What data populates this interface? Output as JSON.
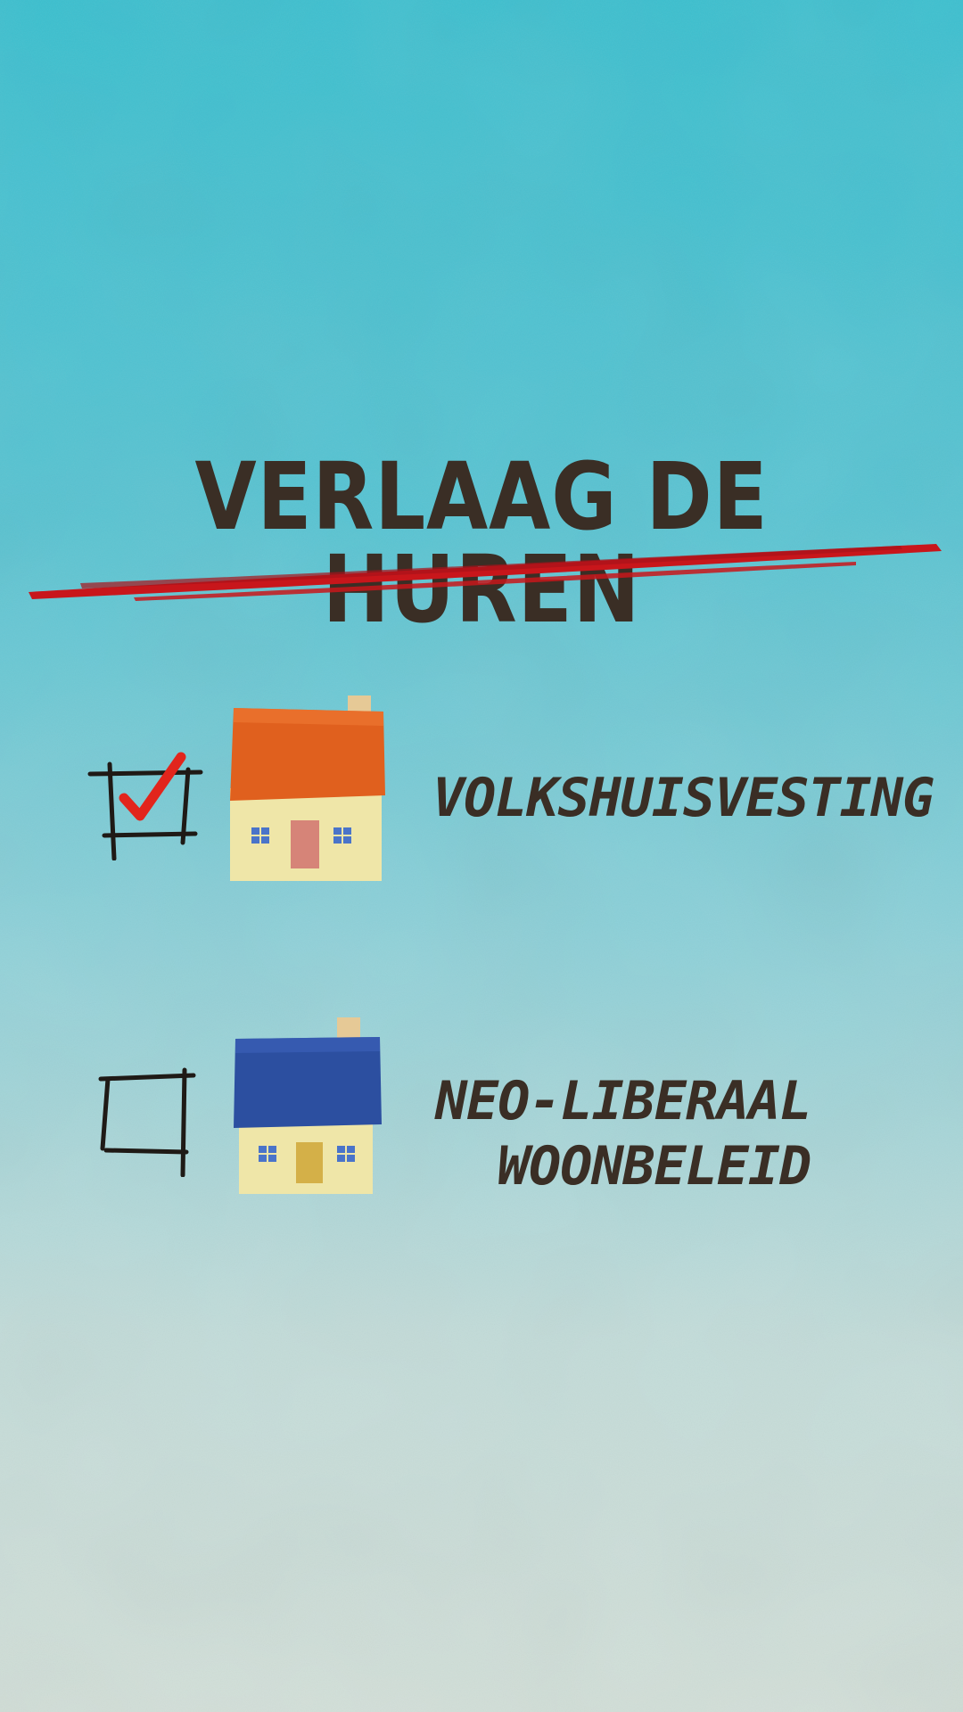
{
  "headline": "VERLAAG DE HUREN",
  "colors": {
    "background_top": "#39bfcf",
    "background_bottom": "#d2dfd8",
    "ink": "#3a2e25",
    "underline": "#c8161b",
    "check": "#e2251c"
  },
  "options": [
    {
      "label_lines": [
        "VOLKSHUISVESTING"
      ],
      "checked": true,
      "icon": "house-orange-roof-icon",
      "roof_color": "#e0601e"
    },
    {
      "label_lines": [
        "NEO-LIBERAAL",
        "WOONBELEID"
      ],
      "checked": false,
      "icon": "house-blue-roof-icon",
      "roof_color": "#2c4fa0"
    }
  ]
}
